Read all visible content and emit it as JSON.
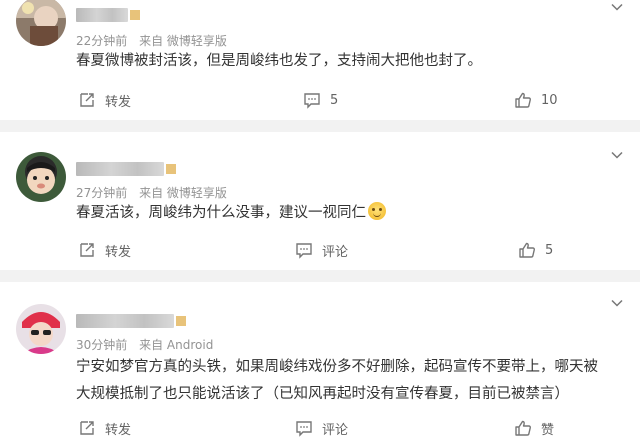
{
  "comments": [
    {
      "time": "22分钟前",
      "source": "来自 微博轻享版",
      "content": "春夏微博被封活该，但是周峻纬也发了，支持闹大把他也封了。",
      "actions": {
        "repost": "转发",
        "comment": "5",
        "like": "10"
      }
    },
    {
      "time": "27分钟前",
      "source": "来自 微博轻享版",
      "content": "春夏活该，周峻纬为什么没事，建议一视同仁",
      "actions": {
        "repost": "转发",
        "comment": "评论",
        "like": "5"
      }
    },
    {
      "time": "30分钟前",
      "source": "来自 Android",
      "content": "宁安如梦官方真的头铁，如果周峻纬戏份多不好删除，起码宣传不要带上，哪天被大规模抵制了也只能说活该了（已知风再起时没有宣传春夏，目前已被禁言）",
      "actions": {
        "repost": "转发",
        "comment": "评论",
        "like": "赞"
      }
    }
  ],
  "icons": {
    "repost": "repost-icon",
    "comment": "comment-icon",
    "like": "thumbs-up-icon",
    "more": "chevron-down-icon"
  },
  "colors": {
    "text": "#333333",
    "meta": "#939393",
    "action": "#636363",
    "divider": "#f2f2f2"
  }
}
